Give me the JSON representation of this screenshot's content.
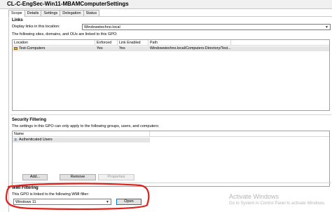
{
  "window": {
    "title": "CL-C-EngSec-Win11-MBAMComputerSettings"
  },
  "tabs": [
    {
      "label": "Scope",
      "active": true
    },
    {
      "label": "Details",
      "active": false
    },
    {
      "label": "Settings",
      "active": false
    },
    {
      "label": "Delegation",
      "active": false
    },
    {
      "label": "Status",
      "active": false
    }
  ],
  "links": {
    "heading": "Links",
    "display_label": "Display links in this location:",
    "location_value": "Windowstechno.local",
    "description": "The following sites, domains, and OUs are linked to this GPO:",
    "columns": [
      "Location",
      "Enforced",
      "Link Enabled",
      "Path"
    ],
    "rows": [
      {
        "location": "Test-Computers",
        "enforced": "Yes",
        "link_enabled": "Yes",
        "path": "Windowstechno.local/Computers-Directory/Test..."
      }
    ]
  },
  "security_filtering": {
    "heading": "Security Filtering",
    "description": "The settings in this GPO can only apply to the following groups, users, and computers:",
    "columns": [
      "Name"
    ],
    "rows": [
      {
        "name": "Authenticated Users"
      }
    ],
    "buttons": {
      "add": "Add...",
      "remove": "Remove",
      "properties": "Properties"
    }
  },
  "wmi_filtering": {
    "heading": "WMI Filtering",
    "description": "This GPO is linked to the following WMI filter:",
    "filter_value": "Windows 11",
    "open_label": "Open"
  },
  "watermark": {
    "title": "Activate Windows",
    "subtitle": "Go to System in Control Panel to activate Windows."
  },
  "colors": {
    "annotation": "#e0211a",
    "selection": "#e5e5e5",
    "focus": "#0078d7"
  }
}
